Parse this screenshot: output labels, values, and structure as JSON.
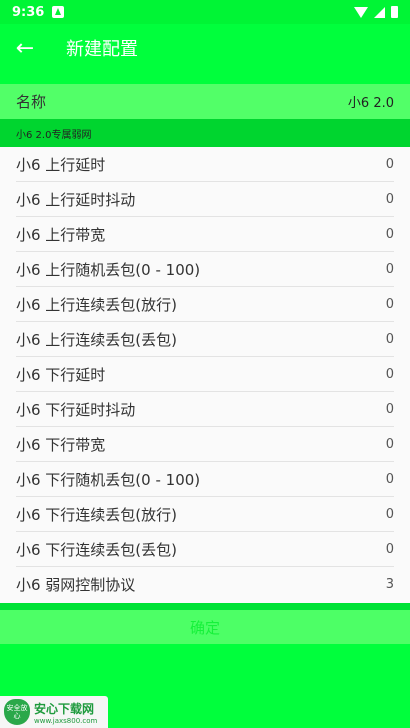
{
  "status_bar": {
    "time": "9:36"
  },
  "toolbar": {
    "back_icon": "←",
    "title": "新建配置"
  },
  "name_row": {
    "label": "名称",
    "value": "小6 2.0"
  },
  "section_header": "小6 2.0专属弱网",
  "settings": [
    {
      "label": "小6  上行延时",
      "value": "0"
    },
    {
      "label": "小6  上行延时抖动",
      "value": "0"
    },
    {
      "label": "小6  上行带宽",
      "value": "0"
    },
    {
      "label": "小6  上行随机丢包(0 - 100)",
      "value": "0"
    },
    {
      "label": "小6  上行连续丢包(放行)",
      "value": "0"
    },
    {
      "label": "小6  上行连续丢包(丢包)",
      "value": "0"
    },
    {
      "label": "小6  下行延时",
      "value": "0"
    },
    {
      "label": "小6  下行延时抖动",
      "value": "0"
    },
    {
      "label": "小6  下行带宽",
      "value": "0"
    },
    {
      "label": "小6  下行随机丢包(0 - 100)",
      "value": "0"
    },
    {
      "label": "小6  下行连续丢包(放行)",
      "value": "0"
    },
    {
      "label": "小6  下行连续丢包(丢包)",
      "value": "0"
    },
    {
      "label": "小6  弱网控制协议",
      "value": "3"
    }
  ],
  "confirm_label": "确定",
  "watermark": {
    "name": "安心下载网",
    "url": "www.jaxs800.com",
    "badge": "安全放心"
  },
  "colors": {
    "primary": "#00ff3c",
    "name_row": "#52ff68",
    "section_header": "#00d52f",
    "list_bg": "#fafafa"
  }
}
